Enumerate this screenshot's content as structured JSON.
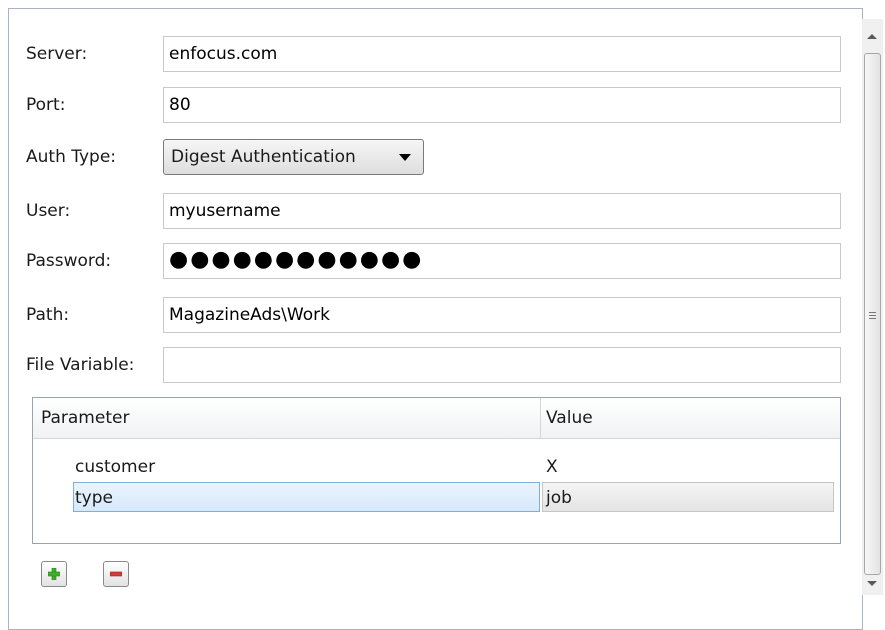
{
  "form": {
    "server": {
      "label": "Server:",
      "value": "enfocus.com"
    },
    "port": {
      "label": "Port:",
      "value": "80"
    },
    "auth_type": {
      "label": "Auth Type:",
      "value": "Digest Authentication"
    },
    "user": {
      "label": "User:",
      "value": "myusername"
    },
    "password": {
      "label": "Password:",
      "value": "●●●●●●●●●●●●"
    },
    "path": {
      "label": "Path:",
      "value": "MagazineAds\\Work"
    },
    "file_variable": {
      "label": "File Variable:",
      "value": ""
    }
  },
  "params_table": {
    "columns": [
      "Parameter",
      "Value"
    ],
    "rows": [
      {
        "parameter": "customer",
        "value": "X"
      },
      {
        "parameter": "type",
        "value": "job",
        "selected": true
      }
    ]
  },
  "buttons": {
    "add_icon": "plus-icon",
    "remove_icon": "minus-icon"
  },
  "colors": {
    "selection": "#d6e9fb",
    "add_green": "#3fae2a",
    "remove_red": "#d43a3a"
  }
}
